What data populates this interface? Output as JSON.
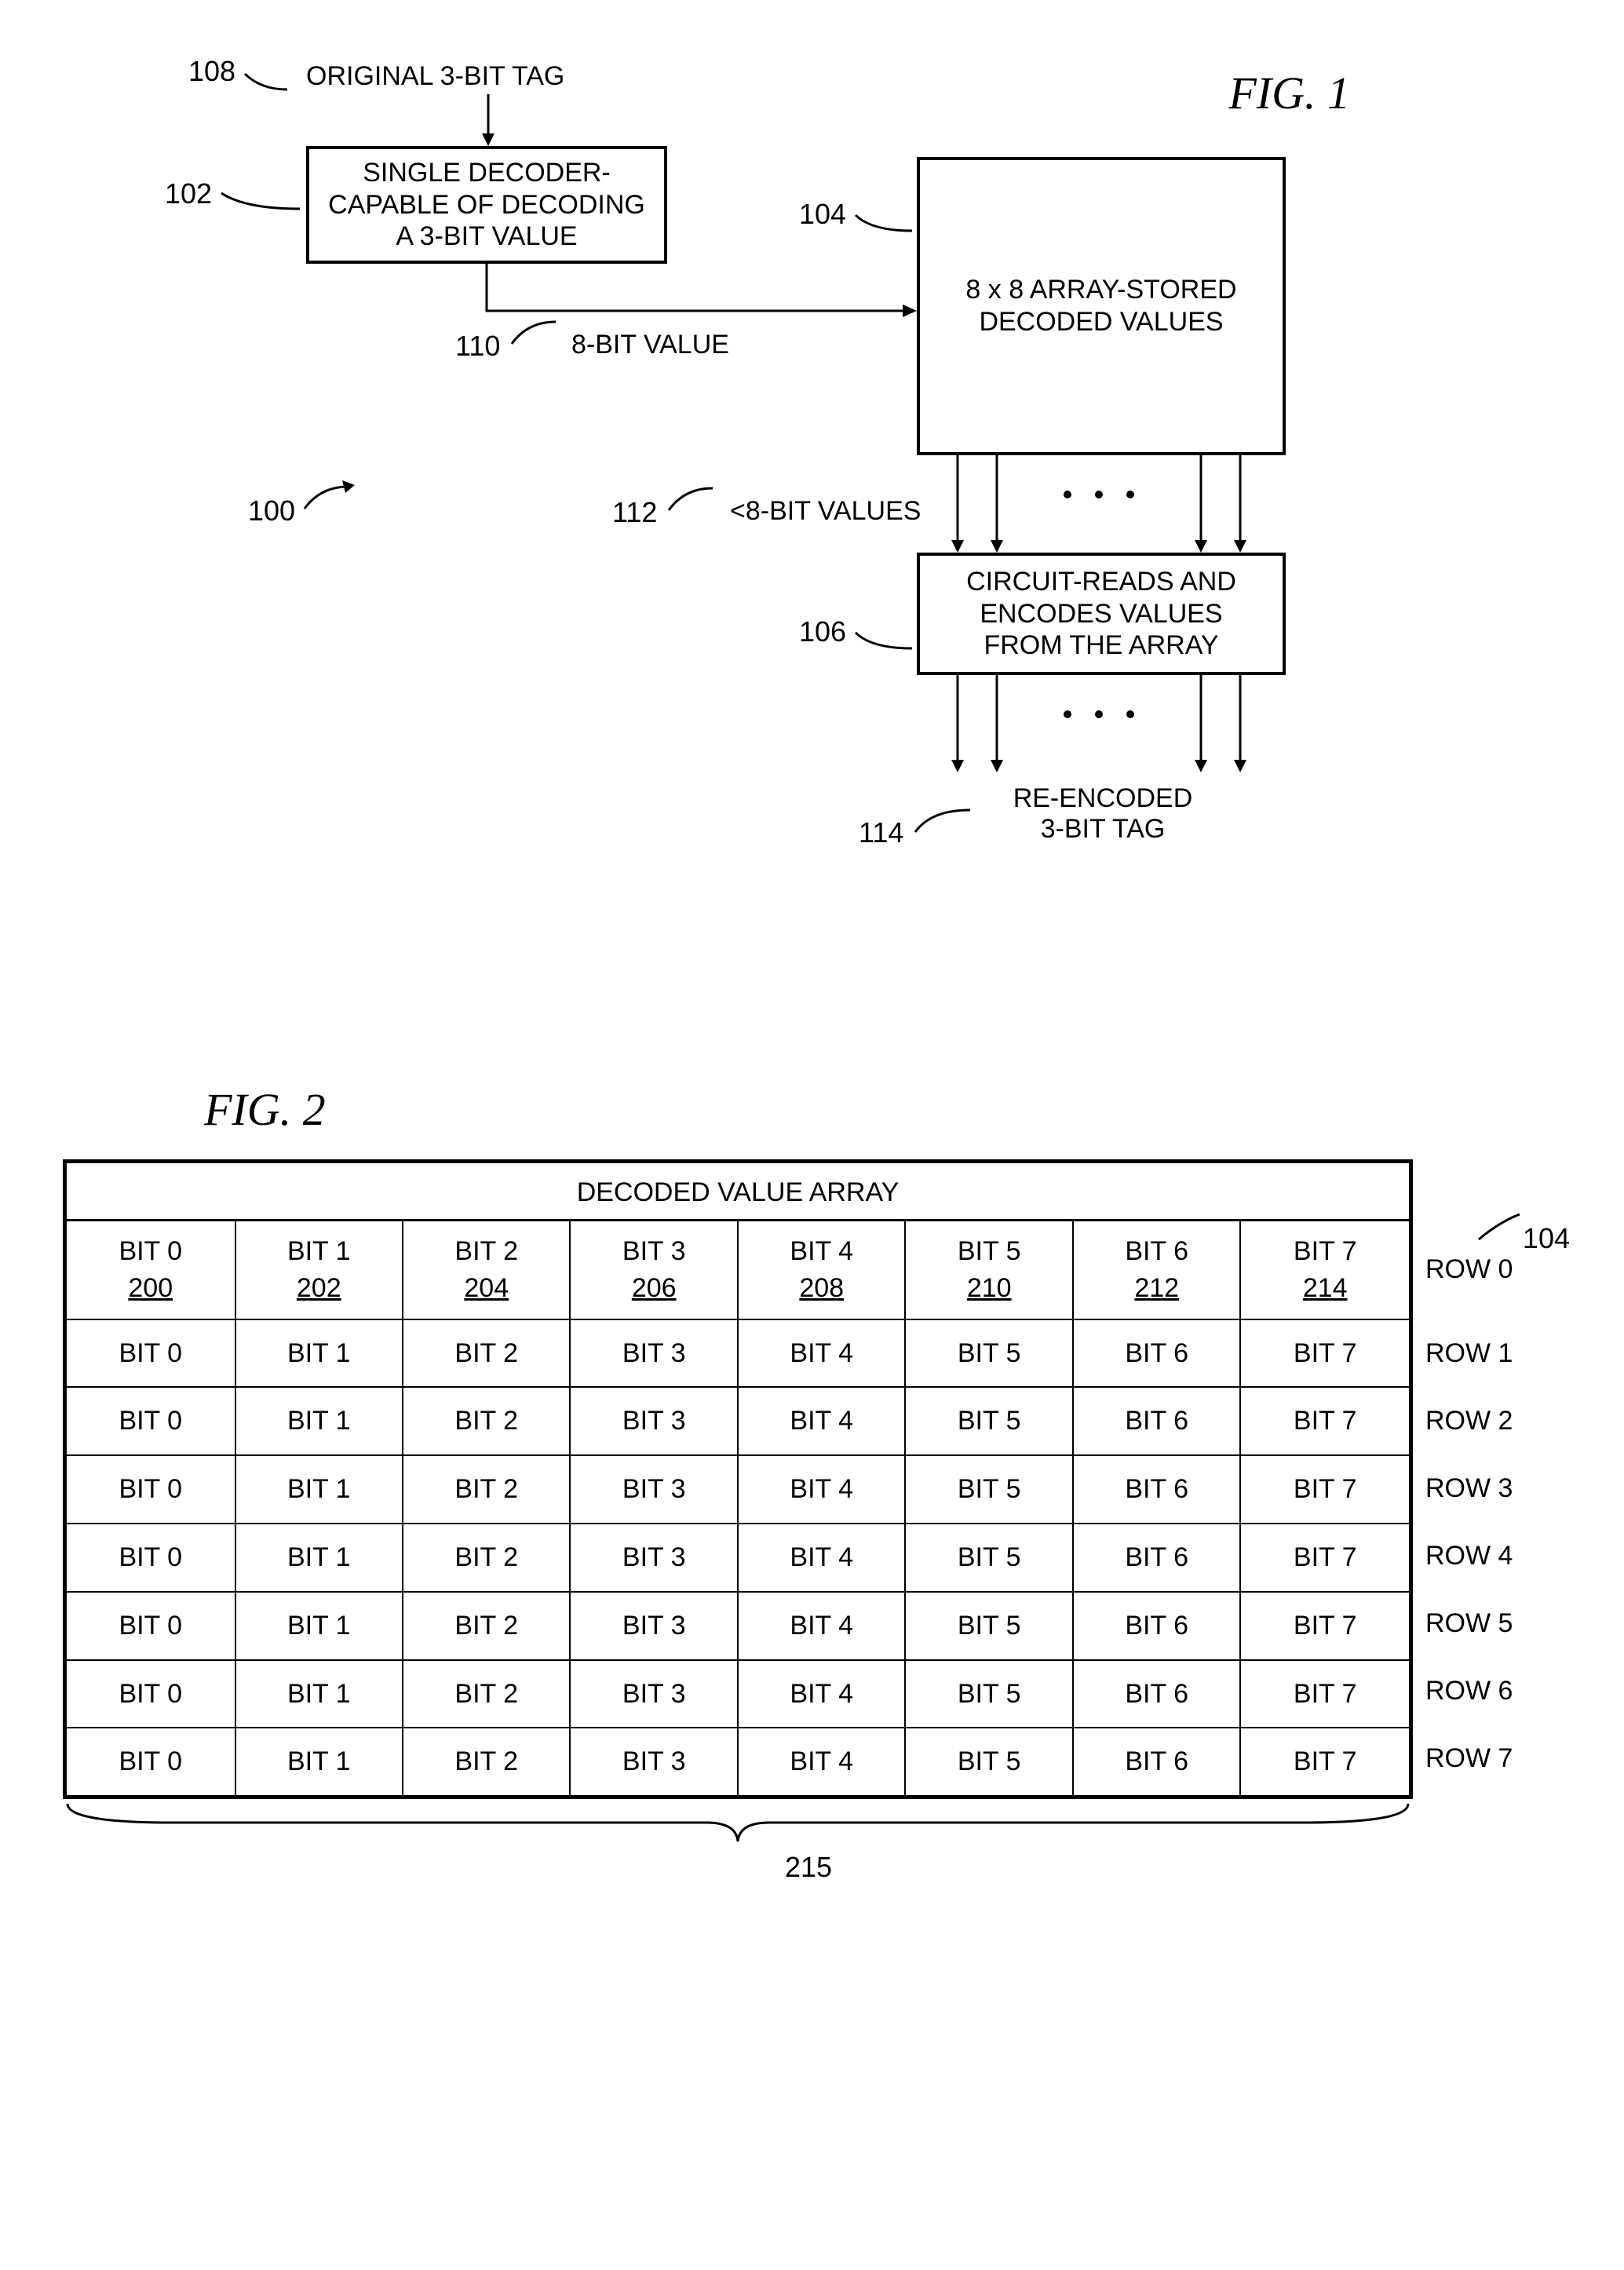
{
  "fig1": {
    "title": "FIG. 1",
    "refs": {
      "r100": "100",
      "r102": "102",
      "r104": "104",
      "r106": "106",
      "r108": "108",
      "r110": "110",
      "r112": "112",
      "r114": "114"
    },
    "labels": {
      "original_tag": "ORIGINAL 3-BIT TAG",
      "decoder_line1": "SINGLE DECODER-",
      "decoder_line2": "CAPABLE OF DECODING",
      "decoder_line3": "A 3-BIT VALUE",
      "eight_bit": "8-BIT VALUE",
      "array_line1": "8 x 8 ARRAY-STORED",
      "array_line2": "DECODED VALUES",
      "lt8bit": "<8-BIT VALUES",
      "circuit_line1": "CIRCUIT-READS AND",
      "circuit_line2": "ENCODES VALUES",
      "circuit_line3": "FROM THE ARRAY",
      "reencoded_line1": "RE-ENCODED",
      "reencoded_line2": "3-BIT TAG"
    }
  },
  "fig2": {
    "title": "FIG. 2",
    "table_title": "DECODED VALUE ARRAY",
    "ref104": "104",
    "ref215": "215",
    "row0_refs": [
      "200",
      "202",
      "204",
      "206",
      "208",
      "210",
      "212",
      "214"
    ],
    "bits": [
      "BIT 0",
      "BIT 1",
      "BIT 2",
      "BIT 3",
      "BIT 4",
      "BIT 5",
      "BIT 6",
      "BIT 7"
    ],
    "row_labels": [
      "ROW 0",
      "ROW 1",
      "ROW 2",
      "ROW 3",
      "ROW 4",
      "ROW 5",
      "ROW 6",
      "ROW 7"
    ]
  }
}
